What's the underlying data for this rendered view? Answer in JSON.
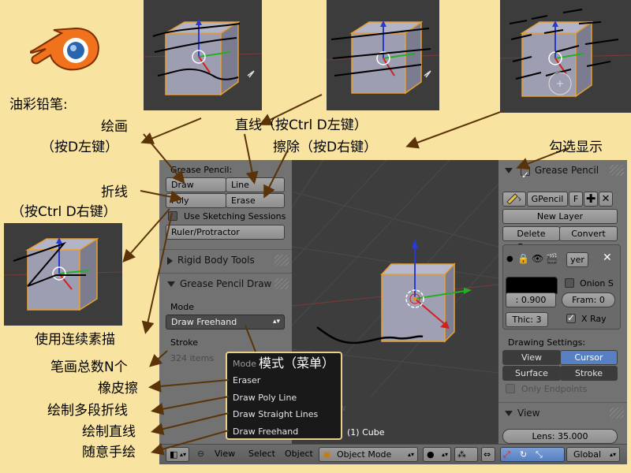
{
  "annotations": {
    "pencil_title": "油彩铅笔:",
    "draw": "绘画",
    "draw_hint": "（按D左键）",
    "line": "直线（按Ctrl D左键）",
    "erase": "擦除（按D右键）",
    "show": "勾选显示",
    "poly": "折线",
    "poly_hint": "（按Ctrl D右键）",
    "sketch": "使用连续素描",
    "stroke_count": "笔画总数N个",
    "eraser": "橡皮擦",
    "draw_poly": "绘制多段折线",
    "draw_straight": "绘制直线",
    "freehand": "随意手绘",
    "mode_menu": "模式（菜单）"
  },
  "left_panel": {
    "grease_pencil_label": "Grease Pencil:",
    "draw_btn": "Draw",
    "line_btn": "Line",
    "poly_btn": "Poly",
    "erase_btn": "Erase",
    "sketch_sessions": "Use Sketching Sessions",
    "ruler_btn": "Ruler/Protractor",
    "rigid_body_tools": "Rigid Body Tools",
    "gp_draw_header": "Grease Pencil Draw",
    "mode_label": "Mode",
    "mode_value": "Draw Freehand",
    "stroke_label": "Stroke",
    "stroke_count": "324 items"
  },
  "mode_menu": {
    "title": "Mode",
    "items": [
      "Eraser",
      "Draw Poly Line",
      "Draw Straight Lines",
      "Draw Freehand"
    ]
  },
  "viewport": {
    "object_label": "(1) Cube",
    "faint_label": "Draw"
  },
  "right_panel": {
    "grease_pencil": "Grease Pencil",
    "gpencil_name": "GPencil",
    "f_btn": "F",
    "new_layer": "New Layer",
    "delete_frame": "Delete Frame",
    "convert": "Convert",
    "layer_name": "yer",
    "opacity": ": 0.900",
    "onion": "Onion S",
    "frame": "Fram: 0",
    "thickness": "Thic: 3",
    "xray": "X Ray",
    "drawing_settings": "Drawing Settings:",
    "view_btn": "View",
    "cursor_btn": "Cursor",
    "surface_btn": "Surface",
    "stroke_btn": "Stroke",
    "only_endpoints": "Only Endpoints",
    "view_header": "View",
    "lens": "Lens: 35.000"
  },
  "header": {
    "view": "View",
    "select": "Select",
    "object": "Object",
    "object_mode": "Object Mode",
    "global": "Global"
  },
  "colors": {
    "background": "#f8e3a0",
    "panel": "#727272",
    "viewport": "#3d3d3d",
    "accent_blue": "#5680c2",
    "stroke_black": "#000000",
    "menu_border": "#e8d08a"
  }
}
